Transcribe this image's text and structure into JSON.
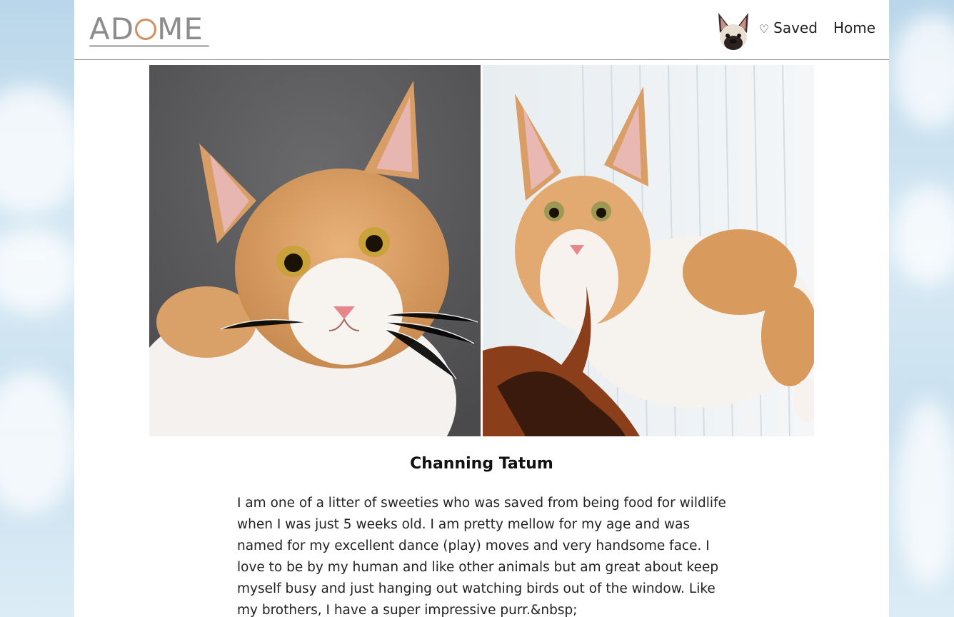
{
  "brand": {
    "logo_text_left": "AD",
    "logo_text_right": "ME",
    "logo_icon": "paw-circle-icon",
    "accent_color": "#cf8f63"
  },
  "header": {
    "avatar_icon": "dog-avatar-icon",
    "saved_icon": "heart-outline-icon",
    "saved_label": "Saved",
    "home_label": "Home"
  },
  "pet": {
    "name": "Channing Tatum",
    "bio": "I am one of a litter of sweeties who was saved from being food for wildlife when I was just 5 weeks old. I am pretty mellow for my age and was named for my excellent dance (play) moves and very handsome face. I love to be by my human and like other animals but am great about keep myself busy and just hanging out watching birds out of the window. Like my brothers, I have a super impressive purr.&nbsp;"
  },
  "photos": [
    {
      "subject": "orange-white-kitten-on-gray-rug"
    },
    {
      "subject": "orange-white-kitten-with-feather-toy"
    }
  ]
}
